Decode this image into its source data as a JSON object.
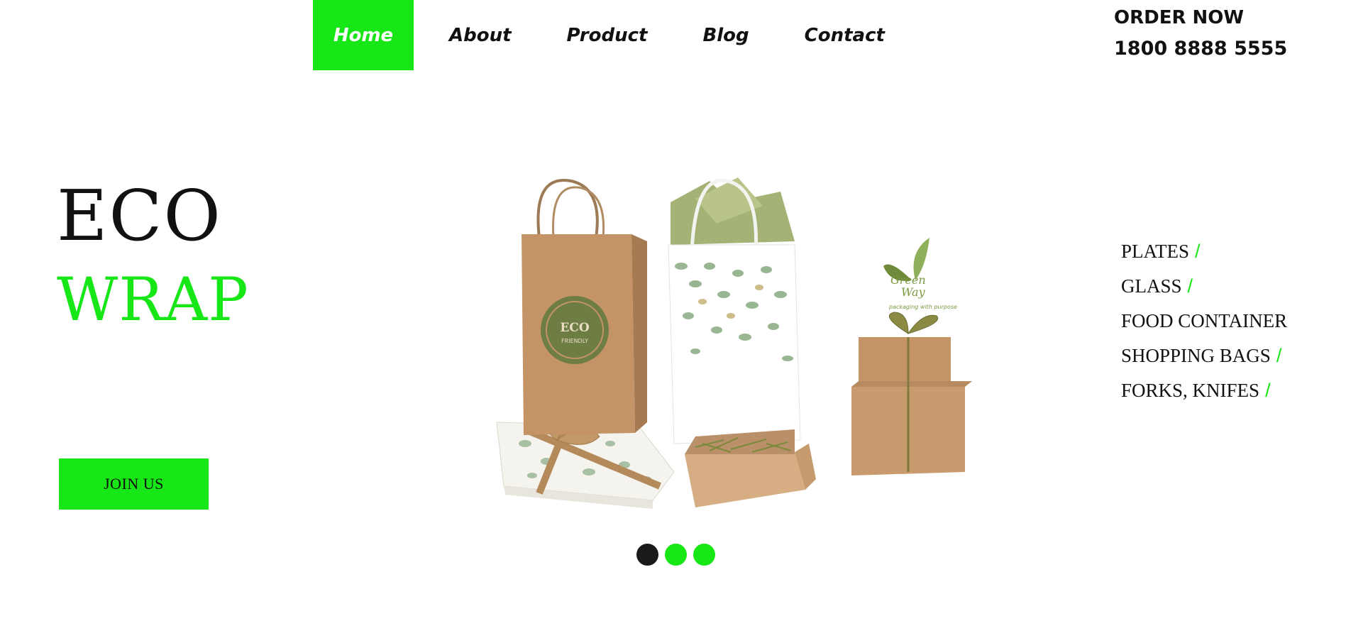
{
  "nav": {
    "items": [
      {
        "label": "Home",
        "active": true
      },
      {
        "label": "About"
      },
      {
        "label": "Product"
      },
      {
        "label": "Blog"
      },
      {
        "label": "Contact"
      }
    ]
  },
  "order": {
    "label": "ORDER NOW",
    "phone": "1800 8888 5555"
  },
  "hero": {
    "title_line1": "ECO",
    "title_line2": "WRAP",
    "cta_label": "JOIN US",
    "image_stamp": "ECO FRIENDLY",
    "image_logo_line1": "Green",
    "image_logo_line2": "Way",
    "image_logo_tagline": "packaging with purpose"
  },
  "slider": {
    "dot_count": 3,
    "active_index": 0
  },
  "categories": [
    {
      "label": "PLATES",
      "slash": "/"
    },
    {
      "label": "GLASS",
      "slash": "/"
    },
    {
      "label": "FOOD CONTAINER",
      "slash": ""
    },
    {
      "label": "SHOPPING BAGS",
      "slash": "/"
    },
    {
      "label": "FORKS, KNIFES",
      "slash": "/"
    }
  ],
  "colors": {
    "accent": "#17e617",
    "text": "#111111",
    "background": "#ffffff",
    "dot_inactive": "#17e617",
    "dot_active": "#1a1a1a"
  }
}
